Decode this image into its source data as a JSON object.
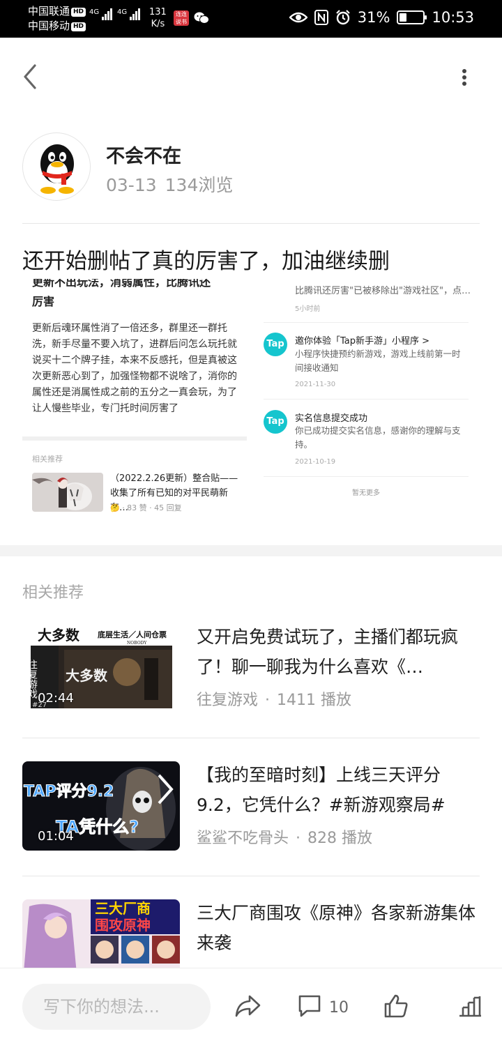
{
  "status_bar": {
    "carrier1": "中国联通",
    "carrier2": "中国移动",
    "hd": "HD",
    "net1": "4G",
    "net2": "4G",
    "speed_value": "131",
    "speed_unit": "K/s",
    "app_badge": "连连 说书",
    "battery": "31%",
    "battery_level": 0.31,
    "time": "10:53"
  },
  "author": {
    "name": "不会不在",
    "date": "03-13",
    "views": "134浏览"
  },
  "post": {
    "title": "还开始删帖了真的厉害了，加油继续删",
    "screenshot": {
      "left_heading_cut": "更新不出玩法，消弱属性，比腾讯还",
      "left_heading": "厉害",
      "left_body": "更新后魂环属性消了一倍还多，群里还一群托洗，新手尽量不要入坑了，进群后问怎么玩托就说买十二个牌子挂，本来不反感托，但是真被这次更新恶心到了，加强怪物都不说啥了，消你的属性还是消属性成之前的五分之一真会玩，为了让人慢些毕业，专门托时间厉害了",
      "rec_label": "相关推荐",
      "rec_title": "（2022.2.26更新）整合贴——收集了所有已知的对平民萌新有…",
      "rec_meta": "🤔 · 83 赞 · 45 回复",
      "right_cut": "比腾讯还厉害\"已被移除出\"游戏社区\"，点…",
      "right_cut_time": "5小时前",
      "notices": [
        {
          "logo": "Tap",
          "title": "邀你体验「Tap新手游」小程序 >",
          "body": "小程序快捷预约新游戏，游戏上线前第一时间接收通知",
          "date": "2021-11-30"
        },
        {
          "logo": "Tap",
          "title": "实名信息提交成功",
          "body": "你已成功提交实名信息，感谢你的理解与支持。",
          "date": "2021-10-19"
        }
      ],
      "no_more": "暂无更多"
    }
  },
  "related": {
    "label": "相关推荐",
    "items": [
      {
        "title": "又开启免费试玩了，主播们都玩疯了！聊一聊我为什么喜欢《…",
        "author": "往复游戏",
        "plays": "1411 播放",
        "duration": "02:44",
        "thumb_text_a": "大多数",
        "thumb_text_b": "底层生活／人间仓票",
        "thumb_text_c": "NOBODY",
        "thumb_text_d": "往复游戏",
        "thumb_text_e": "#27"
      },
      {
        "title": "【我的至暗时刻】上线三天评分9.2，它凭什么？#新游观察局#",
        "author": "鲨鲨不吃骨头",
        "plays": "828 播放",
        "duration": "01:04",
        "thumb_text_a": "TAP评分9.2",
        "thumb_text_b": "TA凭什么?"
      },
      {
        "title": "三大厂商围攻《原神》各家新游集体来袭",
        "author": "",
        "plays": "",
        "duration": "",
        "thumb_text_a": "三大厂商",
        "thumb_text_b": "围攻原神"
      }
    ]
  },
  "bottom_bar": {
    "input_placeholder": "写下你的想法...",
    "comment_count": "10"
  },
  "colors": {
    "tap_brand": "#15c5ce",
    "muted_text": "#9a9a9a"
  }
}
